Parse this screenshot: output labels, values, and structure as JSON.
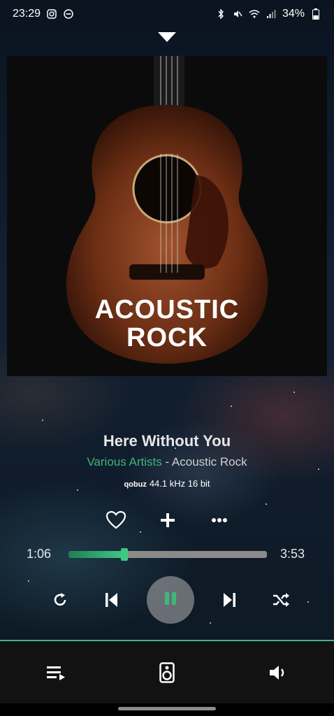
{
  "status_bar": {
    "time": "23:29",
    "battery": "34%",
    "icons_left": [
      "instagram-icon",
      "dnd-icon"
    ],
    "icons_right": [
      "bluetooth-icon",
      "mute-icon",
      "wifi-icon",
      "signal-icon",
      "battery-icon"
    ]
  },
  "album_art": {
    "line1": "ACOUSTIC",
    "line2": "ROCK"
  },
  "track": {
    "title": "Here Without You",
    "artist": "Various Artists",
    "separator": " - ",
    "album": "Acoustic Rock",
    "source": "qobuz",
    "quality": "44.1 kHz 16 bit"
  },
  "playback": {
    "current_time": "1:06",
    "total_time": "3:53",
    "progress_fraction": 0.283,
    "state": "playing"
  },
  "actions": [
    "favorite-heart-icon",
    "add-plus-icon",
    "more-dots-icon"
  ],
  "controls": [
    "repeat-icon",
    "previous-icon",
    "pause-icon",
    "next-icon",
    "shuffle-icon"
  ],
  "bottom_nav": [
    "queue-icon",
    "speaker-output-icon",
    "volume-icon"
  ],
  "colors": {
    "accent": "#3fb67b",
    "progress_track": "#8a8a8a",
    "bottom_bar": "#121212"
  }
}
